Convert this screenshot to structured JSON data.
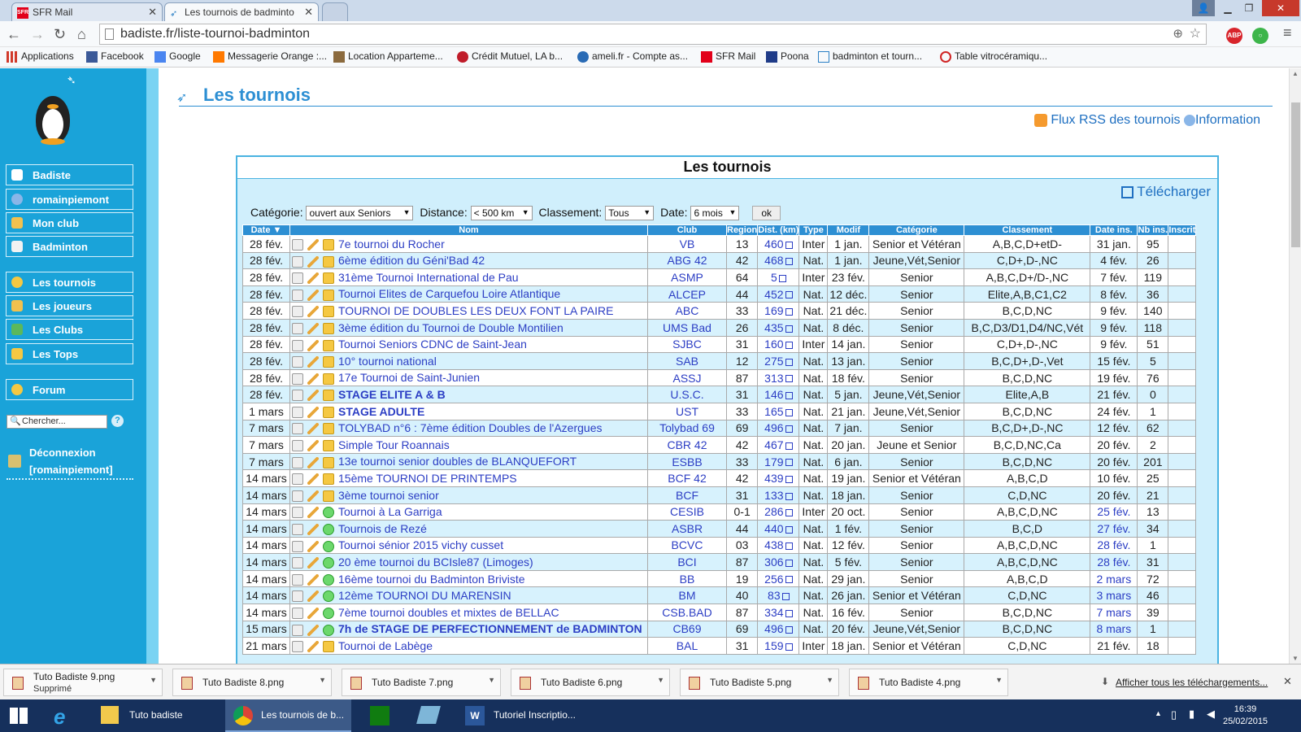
{
  "browser": {
    "tabs": [
      {
        "label": "SFR Mail"
      },
      {
        "label": "Les tournois de badminto"
      }
    ],
    "url": "badiste.fr/liste-tournoi-badminton",
    "extensions": {
      "abp": "ABP"
    },
    "bookmarks": [
      "Applications",
      "Facebook",
      "Google",
      "Messagerie Orange :...",
      "Location Apparteme...",
      "Crédit Mutuel, LA b...",
      "ameli.fr - Compte as...",
      "SFR Mail",
      "Poona",
      "badminton et tourn...",
      "Table vitrocéramiqu..."
    ]
  },
  "sidebar": {
    "items": [
      "Badiste",
      "romainpiemont",
      "Mon club",
      "Badminton"
    ],
    "items2": [
      "Les tournois",
      "Les joueurs",
      "Les Clubs",
      "Les Tops"
    ],
    "forum": "Forum",
    "search_placeholder": "Chercher...",
    "logout_line1": "Déconnexion",
    "logout_line2": "[romainpiemont]"
  },
  "page": {
    "title": "Les tournois",
    "rss": "Flux RSS des tournois",
    "info": "Information",
    "panel_title": "Les tournois",
    "download": "Télécharger",
    "filters": {
      "categorie_label": "Catégorie:",
      "categorie_value": "ouvert aux Seniors",
      "distance_label": "Distance:",
      "distance_value": "< 500 km",
      "classement_label": "Classement:",
      "classement_value": "Tous",
      "date_label": "Date:",
      "date_value": "6 mois",
      "ok": "ok"
    },
    "columns": [
      "Date ▼",
      "Nom",
      "Club",
      "Region",
      "Dist. (km)",
      "Type",
      "Modif",
      "Catégorie",
      "Classement",
      "Date ins.",
      "Nb ins.",
      "Inscrit"
    ],
    "rows": [
      {
        "date": "28 fév.",
        "icon3": "lock",
        "name": "7e tournoi du Rocher",
        "bold": false,
        "club": "VB",
        "region": "13",
        "dist": "460",
        "type": "Inter",
        "modif": "1 jan.",
        "cat": "Senior et Vétéran",
        "classement": "A,B,C,D+etD-",
        "dateins": "31 jan.",
        "dateins_link": false,
        "nb": "95"
      },
      {
        "date": "28 fév.",
        "icon3": "lock",
        "name": "6ème édition du Géni'Bad 42",
        "bold": false,
        "club": "ABG 42",
        "region": "42",
        "dist": "468",
        "type": "Nat.",
        "modif": "1 jan.",
        "cat": "Jeune,Vét,Senior",
        "classement": "C,D+,D-,NC",
        "dateins": "4 fév.",
        "dateins_link": false,
        "nb": "26"
      },
      {
        "date": "28 fév.",
        "icon3": "lock",
        "name": "31ème Tournoi International de Pau",
        "bold": false,
        "club": "ASMP",
        "region": "64",
        "dist": "5",
        "type": "Inter",
        "modif": "23 fév.",
        "cat": "Senior",
        "classement": "A,B,C,D+/D-,NC",
        "dateins": "7 fév.",
        "dateins_link": false,
        "nb": "119"
      },
      {
        "date": "28 fév.",
        "icon3": "lock",
        "name": "Tournoi Elites de Carquefou Loire Atlantique",
        "bold": false,
        "club": "ALCEP",
        "region": "44",
        "dist": "452",
        "type": "Nat.",
        "modif": "12 déc.",
        "cat": "Senior",
        "classement": "Elite,A,B,C1,C2",
        "dateins": "8 fév.",
        "dateins_link": false,
        "nb": "36"
      },
      {
        "date": "28 fév.",
        "icon3": "lock",
        "name": "TOURNOI DE DOUBLES LES DEUX FONT LA PAIRE",
        "bold": false,
        "club": "ABC",
        "region": "33",
        "dist": "169",
        "type": "Nat.",
        "modif": "21 déc.",
        "cat": "Senior",
        "classement": "B,C,D,NC",
        "dateins": "9 fév.",
        "dateins_link": false,
        "nb": "140"
      },
      {
        "date": "28 fév.",
        "icon3": "lock",
        "name": "3ème édition du Tournoi de Double Montilien",
        "bold": false,
        "club": "UMS Bad",
        "region": "26",
        "dist": "435",
        "type": "Nat.",
        "modif": "8 déc.",
        "cat": "Senior",
        "classement": "B,C,D3/D1,D4/NC,Vét",
        "dateins": "9 fév.",
        "dateins_link": false,
        "nb": "118"
      },
      {
        "date": "28 fév.",
        "icon3": "lock",
        "name": "Tournoi Seniors CDNC de Saint-Jean",
        "bold": false,
        "club": "SJBC",
        "region": "31",
        "dist": "160",
        "type": "Inter",
        "modif": "14 jan.",
        "cat": "Senior",
        "classement": "C,D+,D-,NC",
        "dateins": "9 fév.",
        "dateins_link": false,
        "nb": "51"
      },
      {
        "date": "28 fév.",
        "icon3": "lock",
        "name": "10° tournoi national",
        "bold": false,
        "club": "SAB",
        "region": "12",
        "dist": "275",
        "type": "Nat.",
        "modif": "13 jan.",
        "cat": "Senior",
        "classement": "B,C,D+,D-,Vet",
        "dateins": "15 fév.",
        "dateins_link": false,
        "nb": "5"
      },
      {
        "date": "28 fév.",
        "icon3": "lock",
        "name": "17e Tournoi de Saint-Junien",
        "bold": false,
        "club": "ASSJ",
        "region": "87",
        "dist": "313",
        "type": "Nat.",
        "modif": "18 fév.",
        "cat": "Senior",
        "classement": "B,C,D,NC",
        "dateins": "19 fév.",
        "dateins_link": false,
        "nb": "76"
      },
      {
        "date": "28 fév.",
        "icon3": "lock",
        "name": "STAGE ELITE A & B",
        "bold": true,
        "club": "U.S.C.",
        "region": "31",
        "dist": "146",
        "type": "Nat.",
        "modif": "5 jan.",
        "cat": "Jeune,Vét,Senior",
        "classement": "Elite,A,B",
        "dateins": "21 fév.",
        "dateins_link": false,
        "nb": "0"
      },
      {
        "date": "1 mars",
        "icon3": "lock",
        "name": "STAGE ADULTE",
        "bold": true,
        "club": "UST",
        "region": "33",
        "dist": "165",
        "type": "Nat.",
        "modif": "21 jan.",
        "cat": "Jeune,Vét,Senior",
        "classement": "B,C,D,NC",
        "dateins": "24 fév.",
        "dateins_link": false,
        "nb": "1"
      },
      {
        "date": "7 mars",
        "icon3": "lock",
        "name": "TOLYBAD n°6 : 7ème édition Doubles de l'Azergues",
        "bold": false,
        "club": "Tolybad 69",
        "region": "69",
        "dist": "496",
        "type": "Nat.",
        "modif": "7 jan.",
        "cat": "Senior",
        "classement": "B,C,D+,D-,NC",
        "dateins": "12 fév.",
        "dateins_link": false,
        "nb": "62"
      },
      {
        "date": "7 mars",
        "icon3": "lock",
        "name": "Simple Tour Roannais",
        "bold": false,
        "club": "CBR 42",
        "region": "42",
        "dist": "467",
        "type": "Nat.",
        "modif": "20 jan.",
        "cat": "Jeune et Senior",
        "classement": "B,C,D,NC,Ca",
        "dateins": "20 fév.",
        "dateins_link": false,
        "nb": "2"
      },
      {
        "date": "7 mars",
        "icon3": "lock",
        "name": "13e tournoi senior doubles de BLANQUEFORT",
        "bold": false,
        "club": "ESBB",
        "region": "33",
        "dist": "179",
        "type": "Nat.",
        "modif": "6 jan.",
        "cat": "Senior",
        "classement": "B,C,D,NC",
        "dateins": "20 fév.",
        "dateins_link": false,
        "nb": "201"
      },
      {
        "date": "14 mars",
        "icon3": "lock",
        "name": "15ème TOURNOI DE PRINTEMPS",
        "bold": false,
        "club": "BCF 42",
        "region": "42",
        "dist": "439",
        "type": "Nat.",
        "modif": "19 jan.",
        "cat": "Senior et Vétéran",
        "classement": "A,B,C,D",
        "dateins": "10 fév.",
        "dateins_link": false,
        "nb": "25"
      },
      {
        "date": "14 mars",
        "icon3": "lock",
        "name": "3ème tournoi senior",
        "bold": false,
        "club": "BCF",
        "region": "31",
        "dist": "133",
        "type": "Nat.",
        "modif": "18 jan.",
        "cat": "Senior",
        "classement": "C,D,NC",
        "dateins": "20 fév.",
        "dateins_link": false,
        "nb": "21"
      },
      {
        "date": "14 mars",
        "icon3": "add",
        "name": "Tournoi à La Garriga",
        "bold": false,
        "club": "CESIB",
        "region": "0-1",
        "dist": "286",
        "type": "Inter",
        "modif": "20 oct.",
        "cat": "Senior",
        "classement": "A,B,C,D,NC",
        "dateins": "25 fév.",
        "dateins_link": true,
        "nb": "13"
      },
      {
        "date": "14 mars",
        "icon3": "add",
        "name": "Tournois de Rezé",
        "bold": false,
        "club": "ASBR",
        "region": "44",
        "dist": "440",
        "type": "Nat.",
        "modif": "1 fév.",
        "cat": "Senior",
        "classement": "B,C,D",
        "dateins": "27 fév.",
        "dateins_link": true,
        "nb": "34"
      },
      {
        "date": "14 mars",
        "icon3": "add",
        "name": "Tournoi sénior 2015 vichy cusset",
        "bold": false,
        "club": "BCVC",
        "region": "03",
        "dist": "438",
        "type": "Nat.",
        "modif": "12 fév.",
        "cat": "Senior",
        "classement": "A,B,C,D,NC",
        "dateins": "28 fév.",
        "dateins_link": true,
        "nb": "1"
      },
      {
        "date": "14 mars",
        "icon3": "add",
        "name": "20 ème tournoi du BCIsle87 (Limoges)",
        "bold": false,
        "club": "BCI",
        "region": "87",
        "dist": "306",
        "type": "Nat.",
        "modif": "5 fév.",
        "cat": "Senior",
        "classement": "A,B,C,D,NC",
        "dateins": "28 fév.",
        "dateins_link": true,
        "nb": "31"
      },
      {
        "date": "14 mars",
        "icon3": "add",
        "name": "16ème tournoi du Badminton Briviste",
        "bold": false,
        "club": "BB",
        "region": "19",
        "dist": "256",
        "type": "Nat.",
        "modif": "29 jan.",
        "cat": "Senior",
        "classement": "A,B,C,D",
        "dateins": "2 mars",
        "dateins_link": true,
        "nb": "72"
      },
      {
        "date": "14 mars",
        "icon3": "add",
        "name": "12ème TOURNOI DU MARENSIN",
        "bold": false,
        "club": "BM",
        "region": "40",
        "dist": "83",
        "type": "Nat.",
        "modif": "26 jan.",
        "cat": "Senior et Vétéran",
        "classement": "C,D,NC",
        "dateins": "3 mars",
        "dateins_link": true,
        "nb": "46"
      },
      {
        "date": "14 mars",
        "icon3": "add",
        "name": "7ème tournoi doubles et mixtes de BELLAC",
        "bold": false,
        "club": "CSB.BAD",
        "region": "87",
        "dist": "334",
        "type": "Nat.",
        "modif": "16 fév.",
        "cat": "Senior",
        "classement": "B,C,D,NC",
        "dateins": "7 mars",
        "dateins_link": true,
        "nb": "39"
      },
      {
        "date": "15 mars",
        "icon3": "add",
        "name": "7h de STAGE DE PERFECTIONNEMENT de BADMINTON",
        "bold": true,
        "club": "CB69",
        "region": "69",
        "dist": "496",
        "type": "Nat.",
        "modif": "20 fév.",
        "cat": "Jeune,Vét,Senior",
        "classement": "B,C,D,NC",
        "dateins": "8 mars",
        "dateins_link": true,
        "nb": "1"
      },
      {
        "date": "21 mars",
        "icon3": "lock",
        "name": "Tournoi de Labège",
        "bold": false,
        "club": "BAL",
        "region": "31",
        "dist": "159",
        "type": "Inter",
        "modif": "18 jan.",
        "cat": "Senior et Vétéran",
        "classement": "C,D,NC",
        "dateins": "21 fév.",
        "dateins_link": false,
        "nb": "18"
      }
    ]
  },
  "downloads": {
    "items": [
      {
        "name": "Tuto Badiste 9.png",
        "status": "Supprimé"
      },
      {
        "name": "Tuto Badiste 8.png"
      },
      {
        "name": "Tuto Badiste 7.png"
      },
      {
        "name": "Tuto Badiste 6.png"
      },
      {
        "name": "Tuto Badiste 5.png"
      },
      {
        "name": "Tuto Badiste 4.png"
      }
    ],
    "show_all": "Afficher tous les téléchargements..."
  },
  "taskbar": {
    "items": [
      "Tuto badiste",
      "Les tournois de b...",
      "Tutoriel Inscriptio..."
    ],
    "time": "16:39",
    "date": "25/02/2015"
  }
}
